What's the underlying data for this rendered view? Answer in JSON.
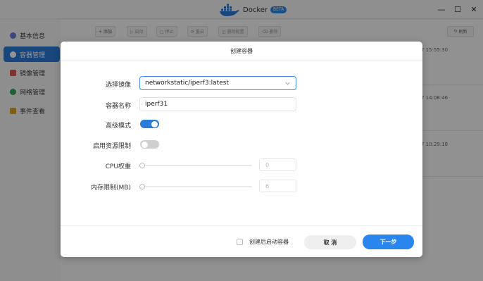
{
  "window": {
    "app_name": "Docker",
    "badge": "BETA",
    "minimize": "—",
    "maximize": "☐",
    "close": "✕",
    "icon": "docker-whale-icon"
  },
  "sidebar": {
    "items": [
      {
        "label": "基本信息",
        "icon": "info-icon",
        "icon_color": "#6a7fd8",
        "active": false
      },
      {
        "label": "容器管理",
        "icon": "container-icon",
        "icon_color": "#ffffff",
        "active": true
      },
      {
        "label": "镜像管理",
        "icon": "image-icon",
        "icon_color": "#e05555",
        "active": false
      },
      {
        "label": "网络管理",
        "icon": "network-icon",
        "icon_color": "#3aa655",
        "active": false
      },
      {
        "label": "事件查看",
        "icon": "event-icon",
        "icon_color": "#e0a020",
        "active": false
      }
    ]
  },
  "toolbar": {
    "buttons": [
      "+ 添加",
      "▷ 启动",
      "□ 停止",
      "⟳ 重启",
      "◫ 删除配置",
      "⌫ 删除"
    ],
    "refresh": "刷新"
  },
  "background_rows": {
    "times": [
      "7 15:55:30",
      "7 14:08:46",
      "7 10:29:18"
    ]
  },
  "modal": {
    "title": "创建容器",
    "fields": {
      "image_label": "选择镜像",
      "image_value": "networkstatic/iperf3:latest",
      "name_label": "容器名称",
      "name_value": "iperf31",
      "advanced_label": "高级模式",
      "advanced_on": true,
      "limit_label": "启用资源限制",
      "limit_on": false,
      "cpu_label": "CPU权重",
      "cpu_value": "0",
      "mem_label": "内存限制(MB)",
      "mem_value": "6"
    },
    "footer": {
      "start_after_create": "创建后启动容器",
      "cancel": "取 消",
      "next": "下一步"
    }
  },
  "colors": {
    "accent": "#2a7ad8",
    "primary_button": "#2a85ee"
  }
}
